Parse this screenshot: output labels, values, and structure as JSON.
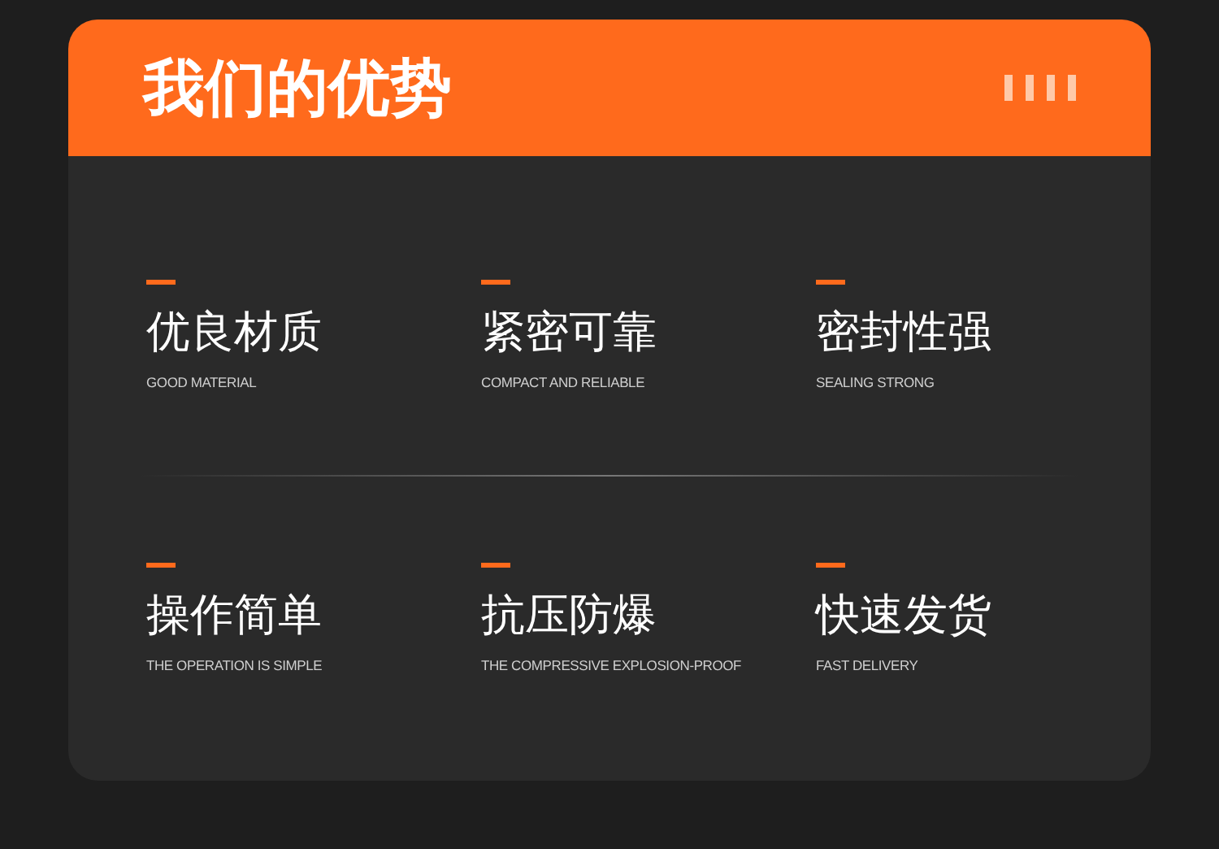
{
  "header": {
    "title": "我们的优势"
  },
  "features": [
    {
      "title": "优良材质",
      "subtitle": "GOOD MATERIAL"
    },
    {
      "title": "紧密可靠",
      "subtitle": "COMPACT AND RELIABLE"
    },
    {
      "title": "密封性强",
      "subtitle": "SEALING STRONG"
    },
    {
      "title": "操作简单",
      "subtitle": "THE OPERATION IS SIMPLE"
    },
    {
      "title": "抗压防爆",
      "subtitle": "THE COMPRESSIVE EXPLOSION-PROOF"
    },
    {
      "title": "快速发货",
      "subtitle": "FAST DELIVERY"
    }
  ]
}
